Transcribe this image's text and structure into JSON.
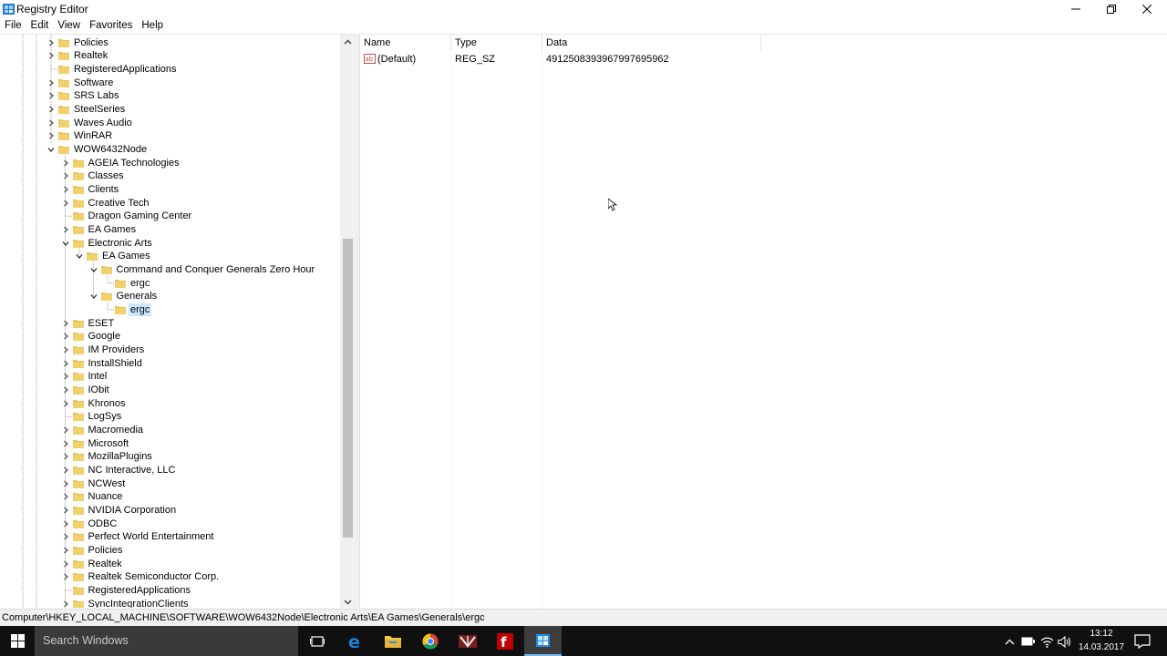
{
  "window": {
    "title": "Registry Editor",
    "icon": "registry-editor-icon"
  },
  "menu": [
    "File",
    "Edit",
    "View",
    "Favorites",
    "Help"
  ],
  "tree": [
    {
      "label": "Policies",
      "depth": 1,
      "state": "collapsed"
    },
    {
      "label": "Realtek",
      "depth": 1,
      "state": "collapsed"
    },
    {
      "label": "RegisteredApplications",
      "depth": 1,
      "state": "leaf"
    },
    {
      "label": "Software",
      "depth": 1,
      "state": "collapsed"
    },
    {
      "label": "SRS Labs",
      "depth": 1,
      "state": "collapsed"
    },
    {
      "label": "SteelSeries",
      "depth": 1,
      "state": "collapsed"
    },
    {
      "label": "Waves Audio",
      "depth": 1,
      "state": "collapsed"
    },
    {
      "label": "WinRAR",
      "depth": 1,
      "state": "collapsed"
    },
    {
      "label": "WOW6432Node",
      "depth": 1,
      "state": "expanded"
    },
    {
      "label": "AGEIA Technologies",
      "depth": 2,
      "state": "collapsed"
    },
    {
      "label": "Classes",
      "depth": 2,
      "state": "collapsed"
    },
    {
      "label": "Clients",
      "depth": 2,
      "state": "collapsed"
    },
    {
      "label": "Creative Tech",
      "depth": 2,
      "state": "collapsed"
    },
    {
      "label": "Dragon Gaming Center",
      "depth": 2,
      "state": "leaf"
    },
    {
      "label": "EA Games",
      "depth": 2,
      "state": "collapsed"
    },
    {
      "label": "Electronic Arts",
      "depth": 2,
      "state": "expanded"
    },
    {
      "label": "EA Games",
      "depth": 3,
      "state": "expanded"
    },
    {
      "label": "Command and Conquer Generals Zero Hour",
      "depth": 4,
      "state": "expanded"
    },
    {
      "label": "ergc",
      "depth": 5,
      "state": "leaf"
    },
    {
      "label": "Generals",
      "depth": 4,
      "state": "expanded"
    },
    {
      "label": "ergc",
      "depth": 5,
      "state": "leaf",
      "selected": true
    },
    {
      "label": "ESET",
      "depth": 2,
      "state": "collapsed"
    },
    {
      "label": "Google",
      "depth": 2,
      "state": "collapsed"
    },
    {
      "label": "IM Providers",
      "depth": 2,
      "state": "collapsed"
    },
    {
      "label": "InstallShield",
      "depth": 2,
      "state": "collapsed"
    },
    {
      "label": "Intel",
      "depth": 2,
      "state": "collapsed"
    },
    {
      "label": "IObit",
      "depth": 2,
      "state": "collapsed"
    },
    {
      "label": "Khronos",
      "depth": 2,
      "state": "collapsed"
    },
    {
      "label": "LogSys",
      "depth": 2,
      "state": "leaf"
    },
    {
      "label": "Macromedia",
      "depth": 2,
      "state": "collapsed"
    },
    {
      "label": "Microsoft",
      "depth": 2,
      "state": "collapsed"
    },
    {
      "label": "MozillaPlugins",
      "depth": 2,
      "state": "collapsed"
    },
    {
      "label": "NC Interactive, LLC",
      "depth": 2,
      "state": "collapsed"
    },
    {
      "label": "NCWest",
      "depth": 2,
      "state": "collapsed"
    },
    {
      "label": "Nuance",
      "depth": 2,
      "state": "collapsed"
    },
    {
      "label": "NVIDIA Corporation",
      "depth": 2,
      "state": "collapsed"
    },
    {
      "label": "ODBC",
      "depth": 2,
      "state": "collapsed"
    },
    {
      "label": "Perfect World Entertainment",
      "depth": 2,
      "state": "collapsed"
    },
    {
      "label": "Policies",
      "depth": 2,
      "state": "collapsed"
    },
    {
      "label": "Realtek",
      "depth": 2,
      "state": "collapsed"
    },
    {
      "label": "Realtek Semiconductor Corp.",
      "depth": 2,
      "state": "collapsed"
    },
    {
      "label": "RegisteredApplications",
      "depth": 2,
      "state": "leaf"
    },
    {
      "label": "SyncIntegrationClients",
      "depth": 2,
      "state": "collapsed"
    }
  ],
  "values": {
    "columns": {
      "name": "Name",
      "type": "Type",
      "data": "Data"
    },
    "rows": [
      {
        "name": "(Default)",
        "type": "REG_SZ",
        "data": "4912508393967997695962",
        "icon": "string-value-icon"
      }
    ]
  },
  "statusbar": {
    "path": "Computer\\HKEY_LOCAL_MACHINE\\SOFTWARE\\WOW6432Node\\Electronic Arts\\EA Games\\Generals\\ergc"
  },
  "taskbar": {
    "search_placeholder": "Search Windows",
    "apps": [
      "task-view-icon",
      "edge-icon",
      "file-explorer-icon",
      "chrome-icon",
      "game-app-icon",
      "filezilla-icon",
      "registry-editor-icon"
    ],
    "active_app": "registry-editor-icon",
    "time": "13:12",
    "date": "14.03.2017"
  },
  "colors": {
    "selection": "#cce8ff",
    "taskbar": "#101010",
    "taskbar_active_underline": "#76b9ed",
    "folder": "#e8c35c"
  }
}
